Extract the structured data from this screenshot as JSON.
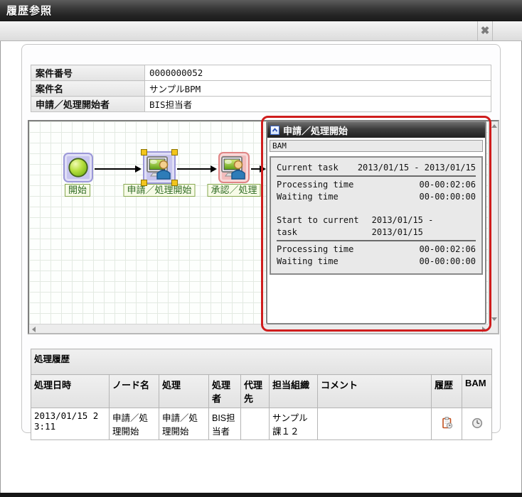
{
  "window": {
    "title": "履歴参照"
  },
  "icons": {
    "close": "✖",
    "collapse": "chevron-up",
    "history": "clipboard-clock",
    "bam": "clock"
  },
  "colors": {
    "accent_red": "#cf1d1d",
    "node_selected_purple": "#c7c5ee",
    "node_current_pink": "#f3bcbc",
    "label_green": "#2f6b22"
  },
  "info_table": {
    "rows": [
      {
        "label": "案件番号",
        "value": "0000000052"
      },
      {
        "label": "案件名",
        "value": "サンプルBPM"
      },
      {
        "label": "申請／処理開始者",
        "value": "BIS担当者"
      }
    ]
  },
  "diagram": {
    "nodes": [
      {
        "label": "開始"
      },
      {
        "label": "申請／処理開始"
      },
      {
        "label": "承認／処理"
      }
    ],
    "detail_panel": {
      "title": "申請／処理開始",
      "bam_label": "BAM",
      "stats": [
        {
          "label": "Current task",
          "value": "2013/01/15 - 2013/01/15"
        },
        {
          "label": "Processing time",
          "value": "00-00:02:06"
        },
        {
          "label": "Waiting time",
          "value": "00-00:00:00"
        },
        {
          "label": "Start to current task",
          "value": "2013/01/15 - 2013/01/15"
        },
        {
          "label": "Processing time",
          "value": "00-00:02:06"
        },
        {
          "label": "Waiting time",
          "value": "00-00:00:00"
        }
      ]
    }
  },
  "history_table": {
    "title": "処理履歴",
    "columns": [
      "処理日時",
      "ノード名",
      "処理",
      "処理者",
      "代理先",
      "担当組織",
      "コメント",
      "履歴",
      "BAM"
    ],
    "rows": [
      {
        "datetime": "2013/01/15 23:11",
        "node_name": "申請／処理開始",
        "action": "申請／処理開始",
        "processor": "BIS担当者",
        "proxy": "",
        "org": "サンプル課１２",
        "comment": ""
      }
    ]
  }
}
